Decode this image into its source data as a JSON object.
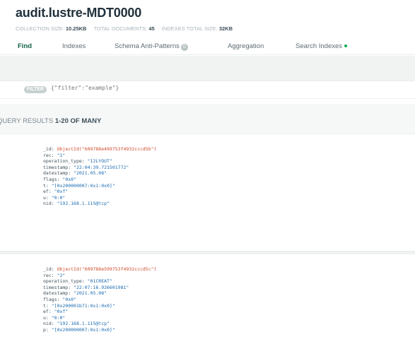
{
  "collection": {
    "title": "audit.lustre-MDT0000",
    "stats": [
      {
        "label": "COLLECTION SIZE:",
        "value": "10.25KB"
      },
      {
        "label": "TOTAL DOCUMENTS:",
        "value": "45"
      },
      {
        "label": "INDEXES TOTAL SIZE:",
        "value": "32KB"
      }
    ]
  },
  "tabs": [
    {
      "label": "Find",
      "active": true
    },
    {
      "label": "Indexes"
    },
    {
      "label": "Schema Anti-Patterns",
      "badge": "0"
    },
    {
      "label": "Aggregation"
    },
    {
      "label": "Search Indexes",
      "status_dot": true
    }
  ],
  "filter": {
    "pill_label": "FILTER",
    "placeholder": "{\"filter\":\"example\"}"
  },
  "results": {
    "label": "QUERY RESULTS",
    "range": "1-20 OF MANY"
  },
  "documents": [
    {
      "fields": [
        {
          "key": "_id",
          "value": "ObjectId(\"609788e499753f4932cccd5b\")"
        },
        {
          "key": "rec",
          "value": "\"1\""
        },
        {
          "key": "operation_type",
          "value": "\"12LYOUT\""
        },
        {
          "key": "timestamp",
          "value": "\"22:04:39.721501772\""
        },
        {
          "key": "datestamp",
          "value": "\"2021.05.08\""
        },
        {
          "key": "flags",
          "value": "\"0x0\""
        },
        {
          "key": "t",
          "value": "\"[0x200000007:0x1:0x0]\""
        },
        {
          "key": "ef",
          "value": "\"0xf\""
        },
        {
          "key": "u",
          "value": "\"0:0\""
        },
        {
          "key": "nid",
          "value": "\"192.168.1.115@tcp\""
        }
      ]
    },
    {
      "fields": [
        {
          "key": "_id",
          "value": "ObjectId(\"609788e599753f4932cccd5c\")"
        },
        {
          "key": "rec",
          "value": "\"2\""
        },
        {
          "key": "operation_type",
          "value": "\"01CREAT\""
        },
        {
          "key": "timestamp",
          "value": "\"22:07:16.926601981\""
        },
        {
          "key": "datestamp",
          "value": "\"2021.05.08\""
        },
        {
          "key": "flags",
          "value": "\"0x0\""
        },
        {
          "key": "t",
          "value": "\"[0x200001b71:0x1:0x0]\""
        },
        {
          "key": "ef",
          "value": "\"0xf\""
        },
        {
          "key": "u",
          "value": "\"0:0\""
        },
        {
          "key": "nid",
          "value": "\"192.168.1.115@tcp\""
        },
        {
          "key": "p",
          "value": "\"[0x200000007:0x1:0x0]\""
        }
      ]
    }
  ],
  "colors": {
    "active_tab": "#116149",
    "object_id": "#cc4b2c",
    "string_value": "#1a6ab0",
    "status_dot": "#13aa52"
  }
}
